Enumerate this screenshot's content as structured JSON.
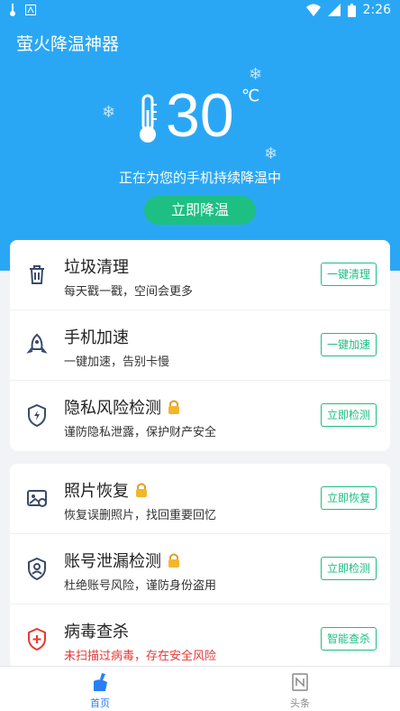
{
  "status_bar": {
    "time": "2:26"
  },
  "app": {
    "title": "萤火降温神器"
  },
  "temperature": {
    "value": "30",
    "unit": "℃"
  },
  "status_text": "正在为您的手机持续降温中",
  "cool_button": "立即降温",
  "card1": [
    {
      "title": "垃圾清理",
      "subtitle": "每天戳一戳，空间会更多",
      "button": "一键清理",
      "icon": "trash-icon",
      "locked": false
    },
    {
      "title": "手机加速",
      "subtitle": "一键加速，告别卡慢",
      "button": "一键加速",
      "icon": "rocket-icon",
      "locked": false
    },
    {
      "title": "隐私风险检测",
      "subtitle": "谨防隐私泄露，保护财产安全",
      "button": "立即检测",
      "icon": "shield-bolt-icon",
      "locked": true
    }
  ],
  "card2": [
    {
      "title": "照片恢复",
      "subtitle": "恢复误删照片，找回重要回忆",
      "button": "立即恢复",
      "icon": "photo-recover-icon",
      "locked": true
    },
    {
      "title": "账号泄漏检测",
      "subtitle": "杜绝账号风险，谨防身份盗用",
      "button": "立即检测",
      "icon": "account-shield-icon",
      "locked": true
    },
    {
      "title": "病毒查杀",
      "subtitle": "未扫描过病毒，存在安全风险",
      "button": "智能查杀",
      "icon": "virus-shield-icon",
      "locked": false,
      "subtitle_color": "#e53935"
    }
  ],
  "nav": [
    {
      "label": "首页",
      "icon": "broom-icon",
      "active": true
    },
    {
      "label": "头条",
      "icon": "news-icon",
      "active": false
    }
  ],
  "colors": {
    "header": "#2aa7f4",
    "accent_green": "#1dbf83",
    "warning_red": "#e53935",
    "nav_active": "#2a7ef4"
  }
}
